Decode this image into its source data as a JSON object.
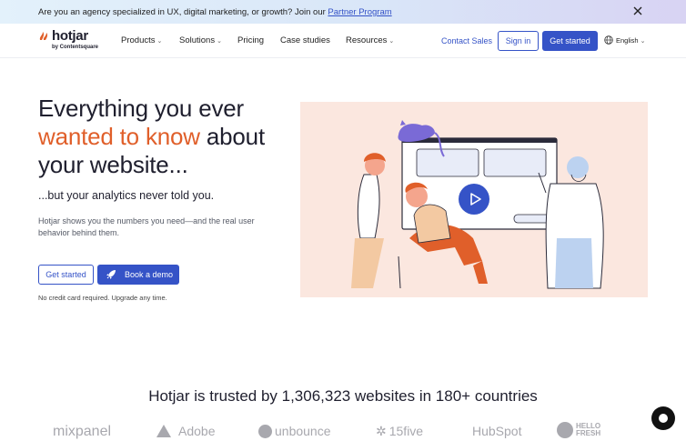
{
  "banner": {
    "text": "Are you an agency specialized in UX, digital marketing, or growth? Join our ",
    "link": "Partner Program",
    "close_icon": "close-icon"
  },
  "nav": {
    "logo": {
      "word": "hotjar",
      "sub": "by Contentsquare"
    },
    "menu": [
      {
        "label": "Products",
        "has_dropdown": true
      },
      {
        "label": "Solutions",
        "has_dropdown": true
      },
      {
        "label": "Pricing",
        "has_dropdown": false
      },
      {
        "label": "Case studies",
        "has_dropdown": false
      },
      {
        "label": "Resources",
        "has_dropdown": true
      }
    ],
    "contact_sales": "Contact Sales",
    "sign_in": "Sign in",
    "get_started": "Get started",
    "language": "English"
  },
  "hero": {
    "headline_line1": "Everything you ever",
    "headline_accent": "wanted to know",
    "headline_line2_rest": " about",
    "headline_line3": "your website...",
    "subheadline": "...but your analytics never told you.",
    "description": "Hotjar shows you the numbers you need—and the real user behavior behind them.",
    "cta_primary": "Get started",
    "cta_demo": "Book a demo",
    "note": "No credit card required. Upgrade any time."
  },
  "trust": {
    "headline": "Hotjar is trusted by 1,306,323 websites in 180+ countries",
    "logos": [
      "mixpanel",
      "Adobe",
      "unbounce",
      "15five",
      "HubSpot",
      "HELLO FRESH"
    ]
  },
  "colors": {
    "accent": "#e05f2a",
    "brand_blue": "#3553c7",
    "illustration_bg": "#fbe7df"
  }
}
